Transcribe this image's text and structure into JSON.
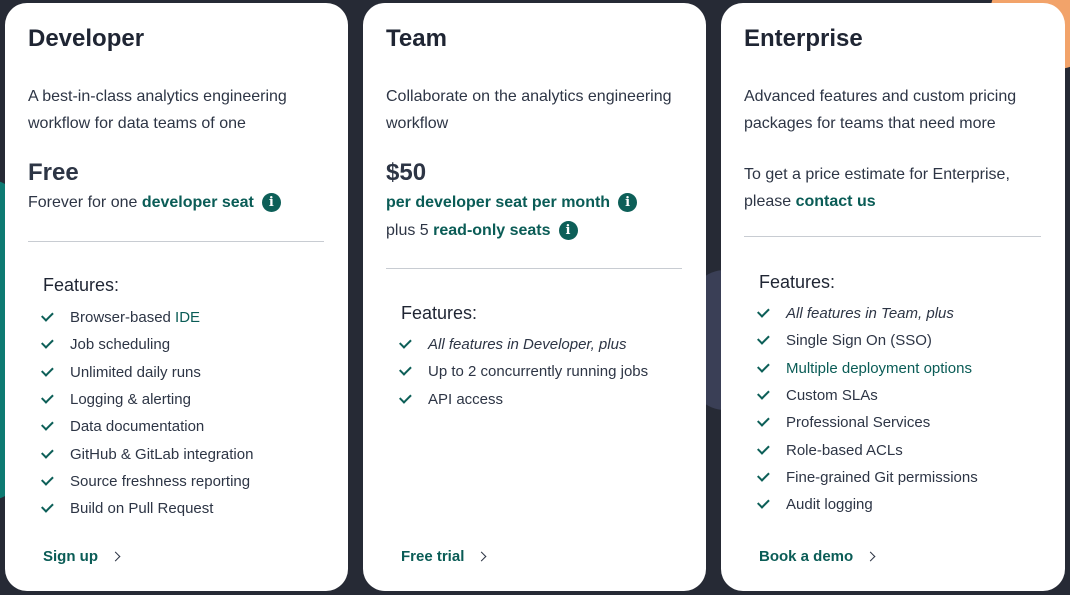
{
  "plans": [
    {
      "title": "Developer",
      "description": "A best-in-class analytics engineering workflow for data teams of one",
      "price": "Free",
      "seat_prefix": "Forever for one ",
      "seat_link": "developer seat",
      "features_heading": "Features:",
      "features": [
        {
          "text": "Browser-based ",
          "link": "IDE"
        },
        {
          "text": "Job scheduling"
        },
        {
          "text": "Unlimited daily runs"
        },
        {
          "text": "Logging & alerting"
        },
        {
          "text": "Data documentation"
        },
        {
          "text": "GitHub & GitLab integration"
        },
        {
          "text": "Source freshness reporting"
        },
        {
          "text": "Build on Pull Request"
        }
      ],
      "cta": "Sign up"
    },
    {
      "title": "Team",
      "description": "Collaborate on the analytics engineering workflow",
      "price": "$50",
      "seat_link": "per developer seat per month",
      "extra_prefix": "plus 5 ",
      "extra_link": "read-only seats",
      "features_heading": "Features:",
      "features": [
        {
          "text": "All features in Developer, plus",
          "italic": true
        },
        {
          "text": "Up to 2 concurrently running jobs"
        },
        {
          "text": "API access"
        }
      ],
      "cta": "Free trial"
    },
    {
      "title": "Enterprise",
      "description": "Advanced features and custom pricing packages for teams that need more",
      "estimate_text": "To get a price estimate for Enterprise, please ",
      "contact_link": "contact us",
      "features_heading": "Features:",
      "features": [
        {
          "text": "All features in Team, plus",
          "italic": true
        },
        {
          "text": "Single Sign On (SSO)"
        },
        {
          "text": "Multiple deployment options",
          "is_link": true
        },
        {
          "text": "Custom SLAs"
        },
        {
          "text": "Professional Services"
        },
        {
          "text": "Role-based ACLs"
        },
        {
          "text": "Fine-grained Git permissions"
        },
        {
          "text": "Audit logging"
        }
      ],
      "cta": "Book a demo"
    }
  ],
  "icons": {
    "info": "info-icon",
    "check": "check-icon",
    "chevron": "chevron-right-icon"
  },
  "colors": {
    "accent": "#0a5c56",
    "text": "#2d3545",
    "background": "#262a35"
  }
}
